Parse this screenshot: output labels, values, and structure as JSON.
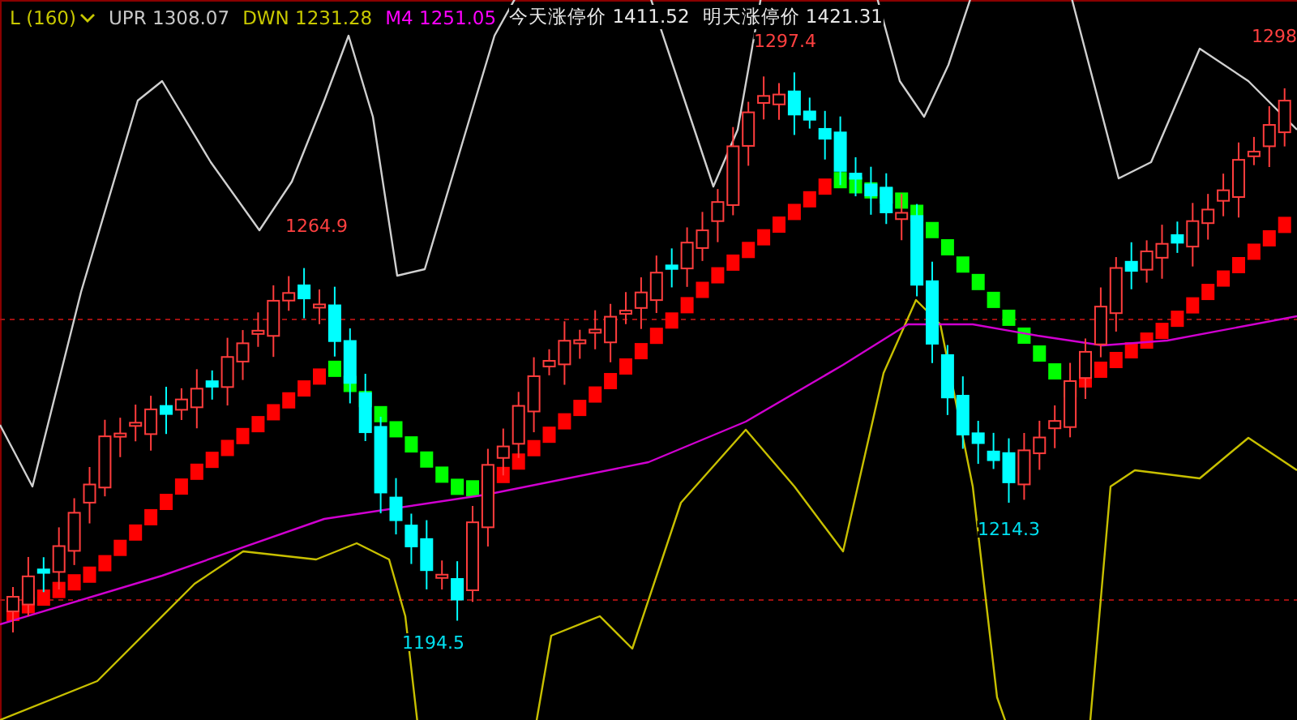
{
  "legend": {
    "indicator": "L (160)",
    "items": [
      {
        "label": "UPR",
        "value": "1308.07",
        "color": "#c8c8c8"
      },
      {
        "label": "DWN",
        "value": "1231.28",
        "color": "#c8c800"
      },
      {
        "label": "M4",
        "value": "1251.05",
        "color": "#ff00ff"
      },
      {
        "label": "今天涨停价",
        "value": "1411.52",
        "color": "#e8e8e8"
      },
      {
        "label": "明天涨停价",
        "value": "1421.31",
        "color": "#e8e8e8"
      }
    ]
  },
  "price_labels": [
    {
      "text": "1264.9",
      "kind": "high"
    },
    {
      "text": "1297.4",
      "kind": "high"
    },
    {
      "text": "1298",
      "kind": "high"
    },
    {
      "text": "1194.5",
      "kind": "low"
    },
    {
      "text": "1214.3",
      "kind": "low"
    }
  ]
}
